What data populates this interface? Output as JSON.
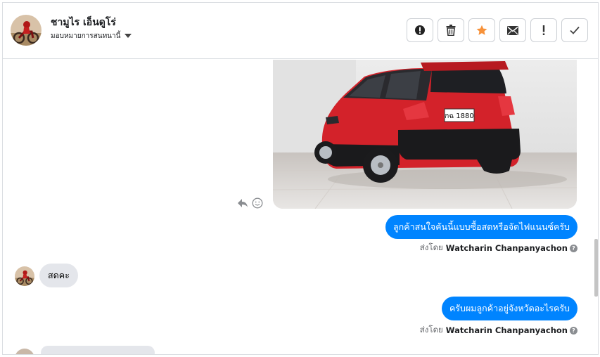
{
  "contact": {
    "name": "ชามูไร เอ็นดูโร่",
    "assign_label": "มอบหมายการสนทนานี้"
  },
  "toolbar": {
    "buttons": [
      {
        "icon": "alert-circle-icon"
      },
      {
        "icon": "trash-icon"
      },
      {
        "icon": "star-icon",
        "color": "#f7923a"
      },
      {
        "icon": "envelope-icon"
      },
      {
        "icon": "exclamation-icon"
      },
      {
        "icon": "checkmark-icon"
      }
    ]
  },
  "messages": [
    {
      "direction": "outgoing",
      "type": "image",
      "description": "red-hatchback-car-photo"
    },
    {
      "direction": "outgoing",
      "type": "text",
      "text": "ลูกค้าสนใจคันนี้แบบซื้อสดหรือจัดไฟแนนซ์ครับ",
      "sent_by_label": "ส่งโดย",
      "sender": "Watcharin Chanpanyachon"
    },
    {
      "direction": "incoming",
      "type": "text",
      "text": "สดคะ"
    },
    {
      "direction": "outgoing",
      "type": "text",
      "text": "ครับผมลูกค้าอยู่จังหวัดอะไรครับ",
      "sent_by_label": "ส่งโดย",
      "sender": "Watcharin Chanpanyachon"
    }
  ],
  "photo": {
    "plate_text": "กฉ 1880"
  },
  "colors": {
    "accent": "#0084ff",
    "incoming_bubble": "#e4e6eb",
    "star": "#f7923a"
  }
}
